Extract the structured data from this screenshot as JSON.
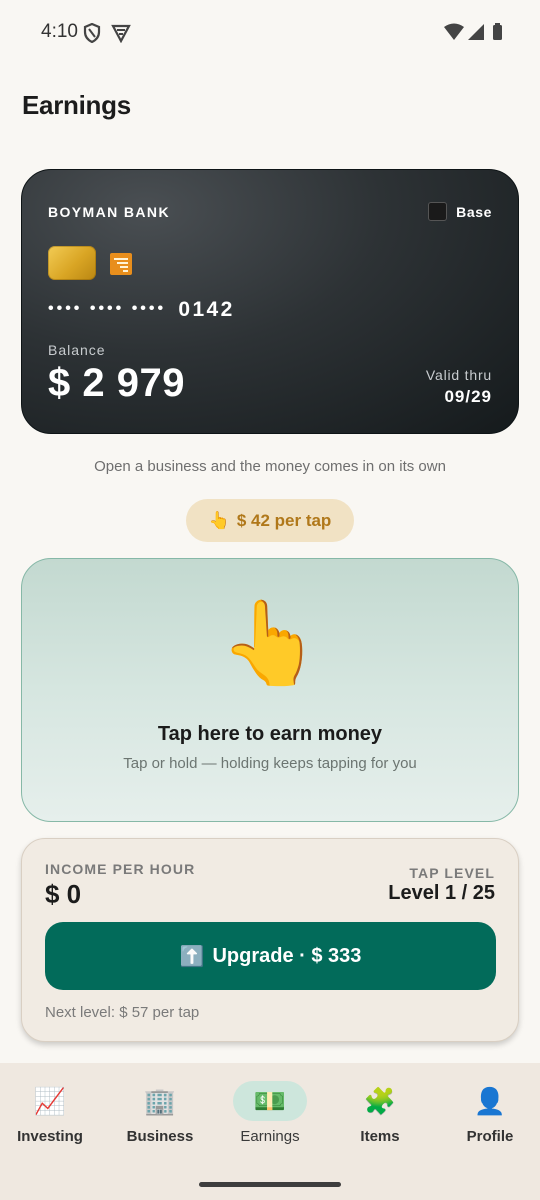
{
  "status_bar": {
    "time": "4:10",
    "icons": [
      "shield-icon",
      "vpn-icon",
      "wifi-icon",
      "signal-icon",
      "battery-icon"
    ]
  },
  "page": {
    "title": "Earnings"
  },
  "card": {
    "bank_name": "BOYMAN BANK",
    "tier_icon": "black-square-icon",
    "tier_label": "Base",
    "number_mask": "•••• •••• ••••",
    "number_last4": "0142",
    "balance_label": "Balance",
    "balance_value": "$ 2 979",
    "valid_label": "Valid thru",
    "valid_value": "09/29"
  },
  "tagline": "Open a business and the money comes in on its own",
  "tap_rate": {
    "icon": "👆",
    "label": "$ 42 per tap"
  },
  "tap_area": {
    "icon": "👆",
    "title": "Tap here to earn money",
    "subtitle": "Tap or hold — holding keeps tapping for you"
  },
  "stats": {
    "income_label": "INCOME PER HOUR",
    "income_value": "$ 0",
    "level_label": "TAP LEVEL",
    "level_value": "Level 1 / 25",
    "upgrade_icon": "⬆️",
    "upgrade_label": "Upgrade · $ 333",
    "next_level": "Next level: $ 57 per tap"
  },
  "nav": {
    "items": [
      {
        "icon": "📈",
        "label": "Investing",
        "active": false
      },
      {
        "icon": "🏢",
        "label": "Business",
        "active": false
      },
      {
        "icon": "💵",
        "label": "Earnings",
        "active": true
      },
      {
        "icon": "🧩",
        "label": "Items",
        "active": false
      },
      {
        "icon": "👤",
        "label": "Profile",
        "active": false
      }
    ]
  },
  "colors": {
    "background": "#f9f7f3",
    "accent": "#026b5a",
    "tap_pill_text": "#b0781a",
    "tap_area_border": "#86b8a7",
    "active_nav_bg": "#cde6dc"
  }
}
